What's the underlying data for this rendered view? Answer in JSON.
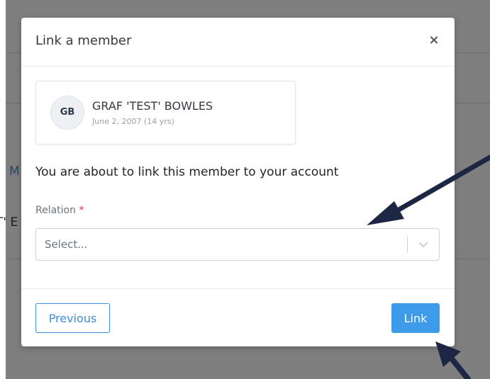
{
  "background": {
    "partial_link": "M",
    "partial_text": "T' E"
  },
  "modal": {
    "title": "Link a member",
    "close_symbol": "×",
    "member": {
      "initials": "GB",
      "name": "GRAF 'TEST' BOWLES",
      "dob": "June 2, 2007 (14 yrs)"
    },
    "message": "You are about to link this member to your account",
    "relation": {
      "label": "Relation",
      "required_marker": "*",
      "placeholder": "Select..."
    },
    "buttons": {
      "previous": "Previous",
      "link": "Link"
    }
  },
  "colors": {
    "primary": "#3d9bea",
    "outline": "#3d8de0",
    "required": "#e3342f",
    "annotation_arrow": "#1d2744"
  }
}
